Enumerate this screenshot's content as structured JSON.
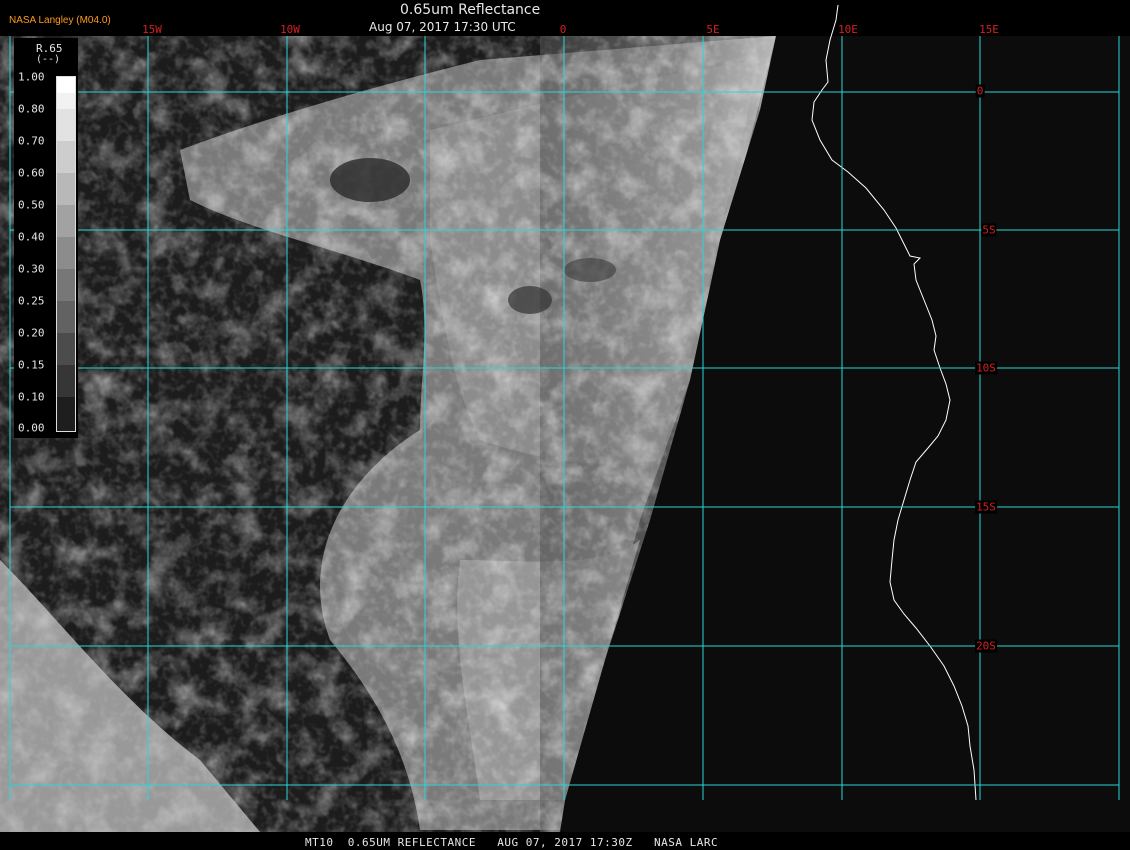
{
  "header": {
    "credit": "NASA Langley (M04.0)",
    "title": "0.65um Reflectance",
    "datetime": "Aug 07, 2017 17:30 UTC"
  },
  "footer": {
    "text": "MT10  0.65UM REFLECTANCE   AUG 07, 2017 17:30Z   NASA LARC"
  },
  "legend": {
    "variable": "R.65",
    "unit": "(--)",
    "ticks": [
      "1.00",
      "0.80",
      "0.70",
      "0.60",
      "0.50",
      "0.40",
      "0.30",
      "0.25",
      "0.20",
      "0.15",
      "0.10",
      "0.00"
    ]
  },
  "grid": {
    "longitudes": [
      "15W",
      "10W",
      "0",
      "5E",
      "10E",
      "15E"
    ],
    "latitudes": [
      "0",
      "5S",
      "10S",
      "15S",
      "20S"
    ]
  },
  "colors": {
    "grid_line": "#2ad6d6",
    "grid_label": "#d42020",
    "coastline": "#ffffff",
    "credit": "#ff9a1a"
  }
}
